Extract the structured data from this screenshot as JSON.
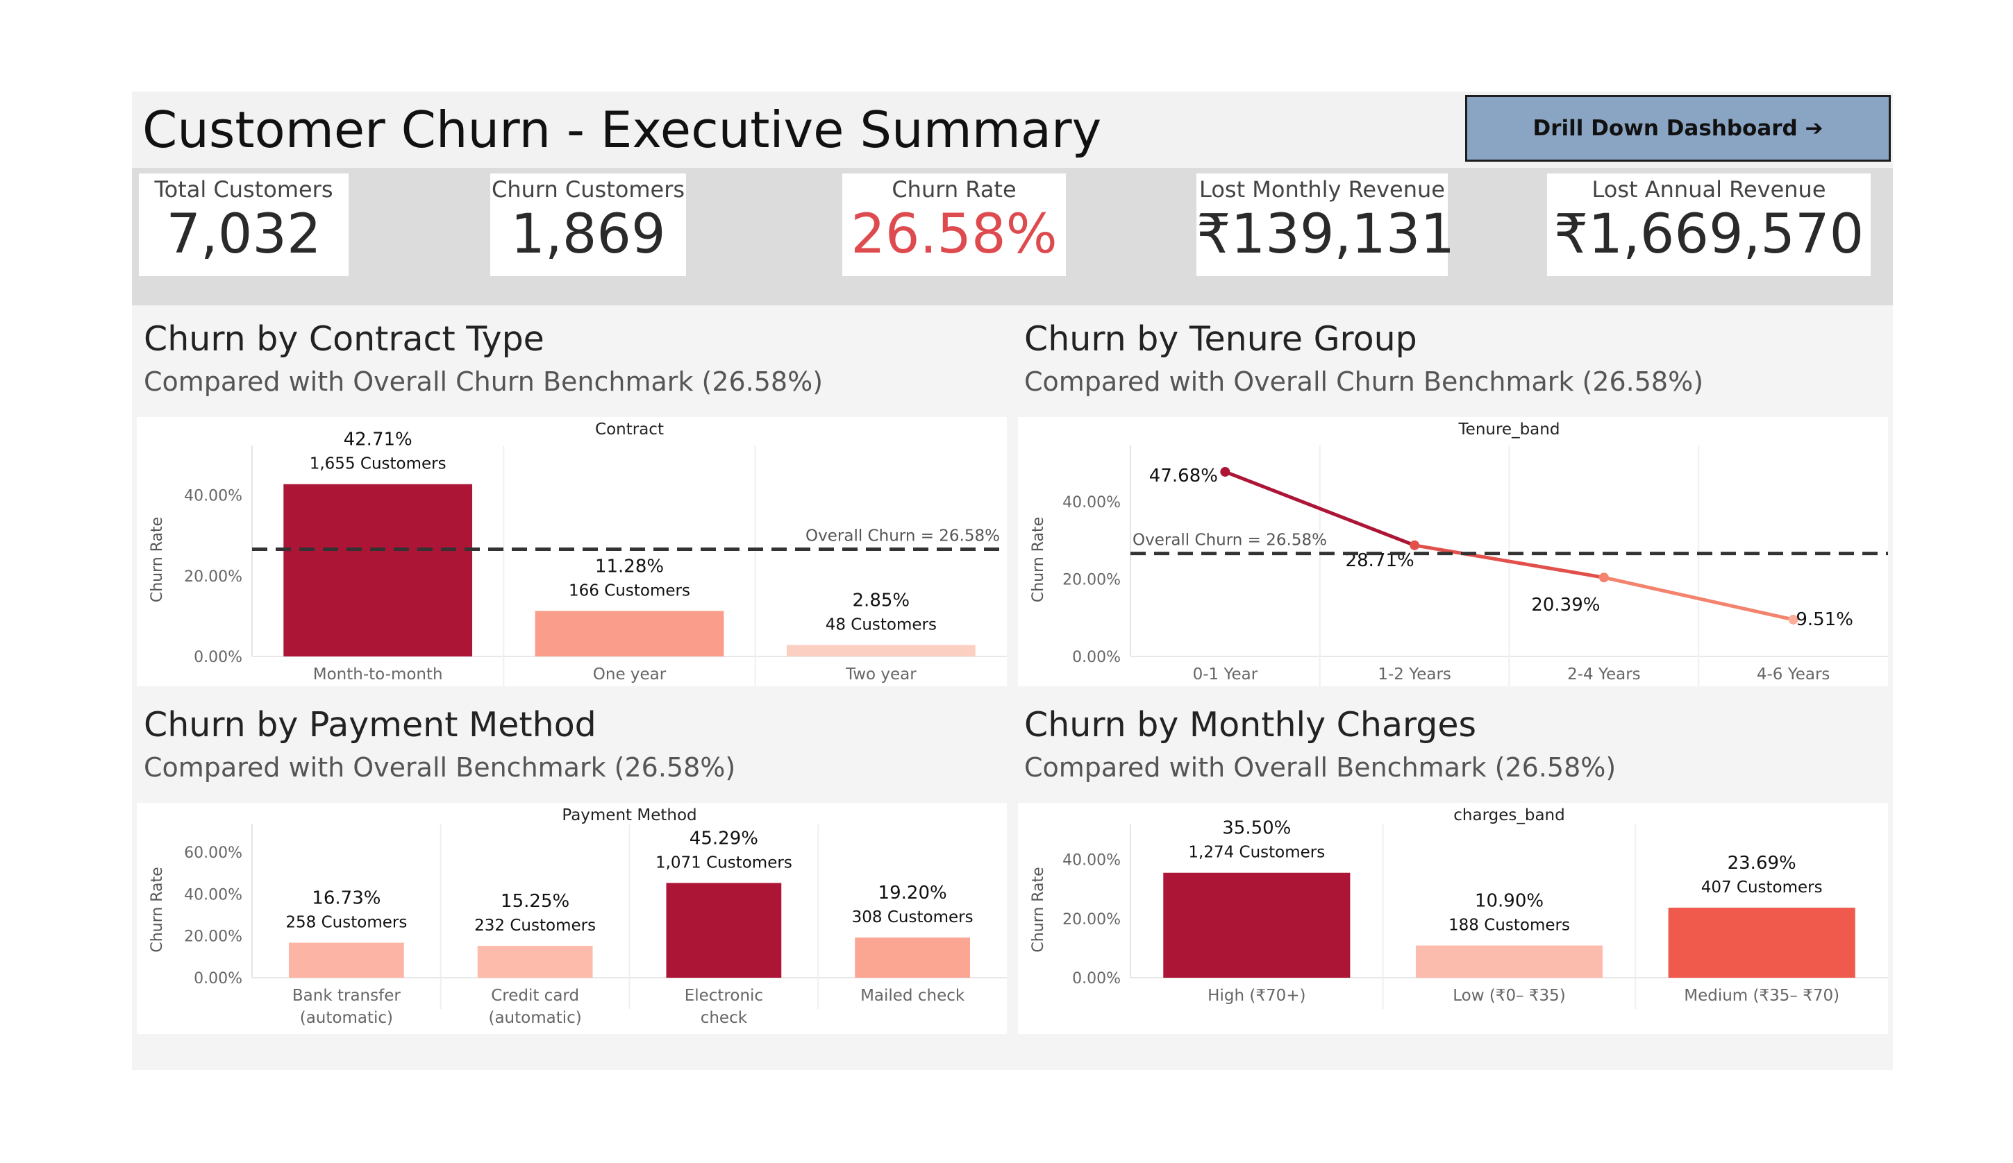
{
  "header": {
    "title": "Customer Churn - Executive Summary",
    "drill_label": "Drill Down Dashboard ➔"
  },
  "kpis": [
    {
      "label": "Total Customers",
      "value": "7,032"
    },
    {
      "label": "Churn Customers",
      "value": "1,869"
    },
    {
      "label": "Churn Rate",
      "value": "26.58%"
    },
    {
      "label": "Lost Monthly Revenue",
      "value": "₹139,131"
    },
    {
      "label": "Lost Annual Revenue",
      "value": "₹1,669,570"
    }
  ],
  "colors": {
    "dark_red": "#ad1536",
    "mid_red": "#f05a4d",
    "salmon": "#fb9d8b",
    "light_salmon": "#fdbbab",
    "pale": "#fccfc3",
    "benchmark": "#333333",
    "churn_rate_kpi": "#de4b4f"
  },
  "sections": {
    "contract": {
      "title": "Churn by Contract Type",
      "subtitle": "Compared with Overall Churn Benchmark (26.58%)"
    },
    "tenure": {
      "title": "Churn by Tenure Group",
      "subtitle": "Compared with Overall Churn Benchmark (26.58%)"
    },
    "payment": {
      "title": "Churn by Payment Method",
      "subtitle": "Compared with Overall Benchmark (26.58%)"
    },
    "charges": {
      "title": "Churn by Monthly Charges",
      "subtitle": "Compared with Overall Benchmark (26.58%)"
    }
  },
  "chart_data": [
    {
      "id": "contract",
      "type": "bar",
      "title": "Contract",
      "ylabel": "Churn Rate",
      "ylim": [
        0,
        48
      ],
      "yticks": [
        0,
        20,
        40
      ],
      "tick_labels": [
        "0.00%",
        "20.00%",
        "40.00%"
      ],
      "categories": [
        "Month-to-month",
        "One year",
        "Two year"
      ],
      "values": [
        42.71,
        11.28,
        2.85
      ],
      "labels": [
        "42.71%",
        "11.28%",
        "2.85%"
      ],
      "customers": [
        "1,655 Customers",
        "166 Customers",
        "48 Customers"
      ],
      "colors": [
        "#ad1536",
        "#fb9d8b",
        "#fccfc3"
      ],
      "benchmark": 26.58,
      "benchmark_label": "Overall Churn = 26.58%"
    },
    {
      "id": "tenure",
      "type": "line",
      "title": "Tenure_band",
      "ylabel": "Churn Rate",
      "ylim": [
        0,
        50
      ],
      "yticks": [
        0,
        20,
        40
      ],
      "tick_labels": [
        "0.00%",
        "20.00%",
        "40.00%"
      ],
      "categories": [
        "0-1 Year",
        "1-2 Years",
        "2-4 Years",
        "4-6 Years"
      ],
      "values": [
        47.68,
        28.71,
        20.39,
        9.51
      ],
      "labels": [
        "47.68%",
        "28.71%",
        "20.39%",
        "9.51%"
      ],
      "colors": [
        "#ad1536",
        "#e2504b",
        "#f4836d",
        "#fdae9a"
      ],
      "benchmark": 26.58,
      "benchmark_label": "Overall Churn = 26.58%"
    },
    {
      "id": "payment",
      "type": "bar",
      "title": "Payment Method",
      "ylabel": "Churn Rate",
      "ylim": [
        0,
        65
      ],
      "yticks": [
        0,
        20,
        40,
        60
      ],
      "tick_labels": [
        "0.00%",
        "20.00%",
        "40.00%",
        "60.00%"
      ],
      "categories": [
        "Bank transfer (automatic)",
        "Credit card (automatic)",
        "Electronic check",
        "Mailed check"
      ],
      "values": [
        16.73,
        15.25,
        45.29,
        19.2
      ],
      "labels": [
        "16.73%",
        "15.25%",
        "45.29%",
        "19.20%"
      ],
      "customers": [
        "258 Customers",
        "232 Customers",
        "1,071 Customers",
        "308 Customers"
      ],
      "colors": [
        "#fcb5a4",
        "#fdbbab",
        "#ad1536",
        "#fba593"
      ]
    },
    {
      "id": "charges",
      "type": "bar",
      "title": "charges_band",
      "ylabel": "Churn Rate",
      "ylim": [
        0,
        46
      ],
      "yticks": [
        0,
        20,
        40
      ],
      "tick_labels": [
        "0.00%",
        "20.00%",
        "40.00%"
      ],
      "categories": [
        "High (₹70+)",
        "Low (₹0– ₹35)",
        "Medium (₹35– ₹70)"
      ],
      "values": [
        35.5,
        10.9,
        23.69
      ],
      "labels": [
        "35.50%",
        "10.90%",
        "23.69%"
      ],
      "customers": [
        "1,274 Customers",
        "188 Customers",
        "407 Customers"
      ],
      "colors": [
        "#ad1536",
        "#fcbcad",
        "#f05a4d"
      ]
    }
  ]
}
